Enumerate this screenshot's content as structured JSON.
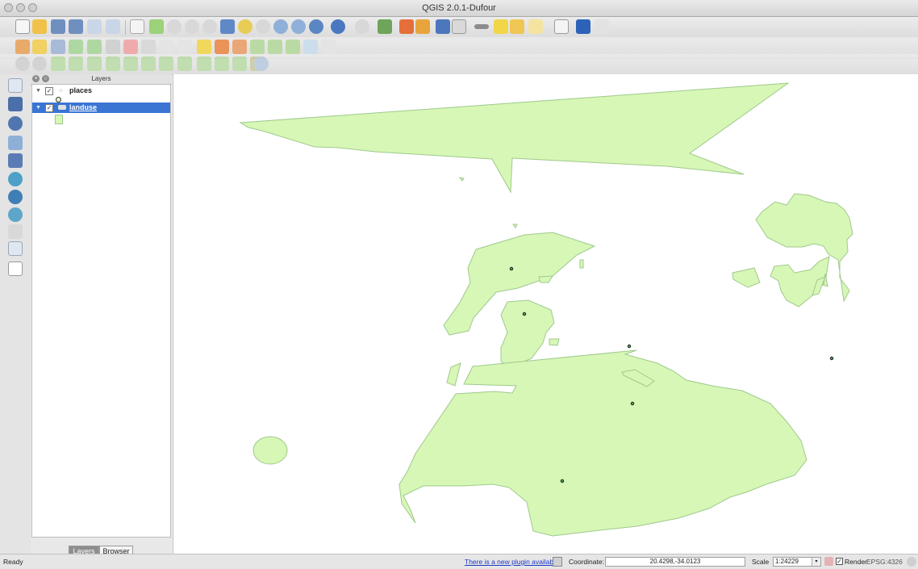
{
  "window": {
    "title": "QGIS 2.0.1-Dufour"
  },
  "layers_panel": {
    "title": "Layers",
    "layers": [
      {
        "name": "places",
        "checked": true,
        "selected": false
      },
      {
        "name": "landuse",
        "checked": true,
        "selected": true
      }
    ],
    "tabs": [
      "Layers",
      "Browser"
    ],
    "active_tab": "Layers"
  },
  "status": {
    "ready": "Ready",
    "plugin_link": "There is a new plugin available",
    "coordinate_label": "Coordinate:",
    "coordinate_value": "20.4298,-34.0123",
    "scale_label": "Scale",
    "scale_value": "1:24229",
    "render_label": "Render",
    "render_checked": true,
    "crs": "EPSG:4326"
  },
  "colors": {
    "landuse_fill": "#d7f7b6",
    "landuse_stroke": "#9fc98c",
    "selection": "#3a75d4",
    "link": "#1a35c8"
  }
}
